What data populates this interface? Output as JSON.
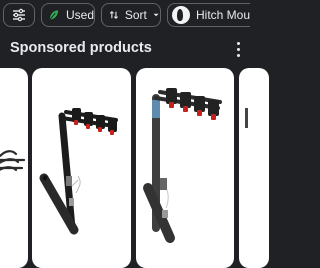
{
  "filters": {
    "filter_icon": "tune-icon",
    "used_label": "Used",
    "used_icon": "leaf-icon",
    "sort_label": "Sort",
    "sort_icon": "sort-arrows-icon",
    "sort_dropdown_icon": "chevron-down-icon",
    "hitch_label": "Hitch Mount"
  },
  "section": {
    "title": "Sponsored products",
    "more_icon": "more-vertical-icon"
  },
  "products": [
    {
      "image": "bike-rack-partial"
    },
    {
      "image": "hitch-mount-bike-rack"
    },
    {
      "image": "hitch-mount-bike-rack-gray"
    },
    {
      "image": "product-partial"
    }
  ],
  "colors": {
    "background": "#202124",
    "leaf_green": "#34a853",
    "rack_red": "#c5221f"
  }
}
